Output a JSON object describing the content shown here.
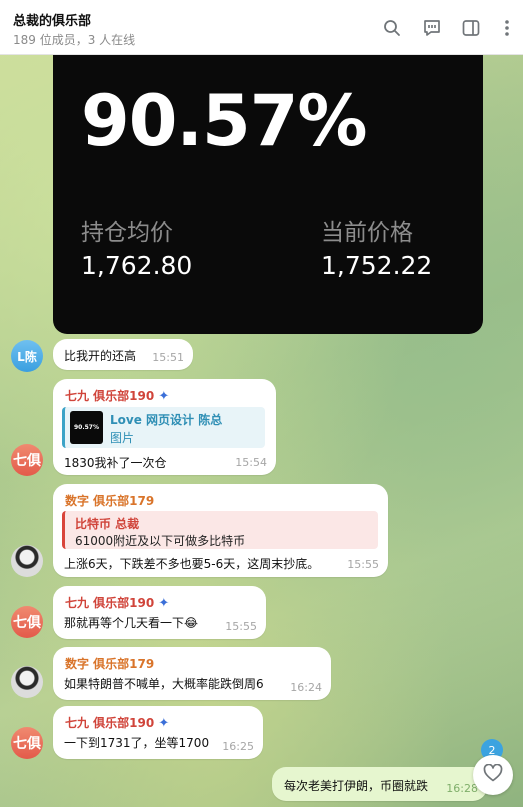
{
  "header": {
    "title": "总裁的俱乐部",
    "subtitle": "189 位成员，3 人在线",
    "icons": [
      "search-icon",
      "chat-icon",
      "sidebar-icon",
      "more-icon"
    ]
  },
  "photo_card": {
    "percent": "90.57%",
    "label_left": "持仓均价",
    "value_left": "1,762.80",
    "label_right": "当前价格",
    "value_right": "1,752.22"
  },
  "messages": [
    {
      "avatar": "L陈",
      "text": "比我开的还高",
      "time": "15:51"
    },
    {
      "avatar": "七俱",
      "sender": "七九 俱乐部190",
      "reply_title": "Love 网页设计 陈总",
      "reply_text": "图片",
      "reply_thumb": "90.57%",
      "text": "1830我补了一次仓",
      "time": "15:54"
    },
    {
      "sender": "数字 俱乐部179",
      "reply_title": "比特币 总裁",
      "reply_text": "61000附近及以下可做多比特币",
      "text": "上涨6天，下跌差不多也要5-6天，这周末抄底。",
      "time": "15:55"
    },
    {
      "avatar": "七俱",
      "sender": "七九 俱乐部190",
      "text": "那就再等个几天看一下😂",
      "time": "15:55"
    },
    {
      "sender": "数字 俱乐部179",
      "text": "如果特朗普不喊单，大概率能跌倒周6",
      "time": "16:24"
    },
    {
      "avatar": "七俱",
      "sender": "七九 俱乐部190",
      "text": "一下到1731了，坐等1700",
      "time": "16:25"
    },
    {
      "text": "每次老美打伊朗，币圈就跌",
      "time": "16:28"
    }
  ],
  "fab": {
    "badge": "2",
    "icon": "heart-icon"
  },
  "colors": {
    "accent": "#3ba3e0",
    "sender_red": "#d0443a",
    "sender_orange": "#d9742a"
  }
}
